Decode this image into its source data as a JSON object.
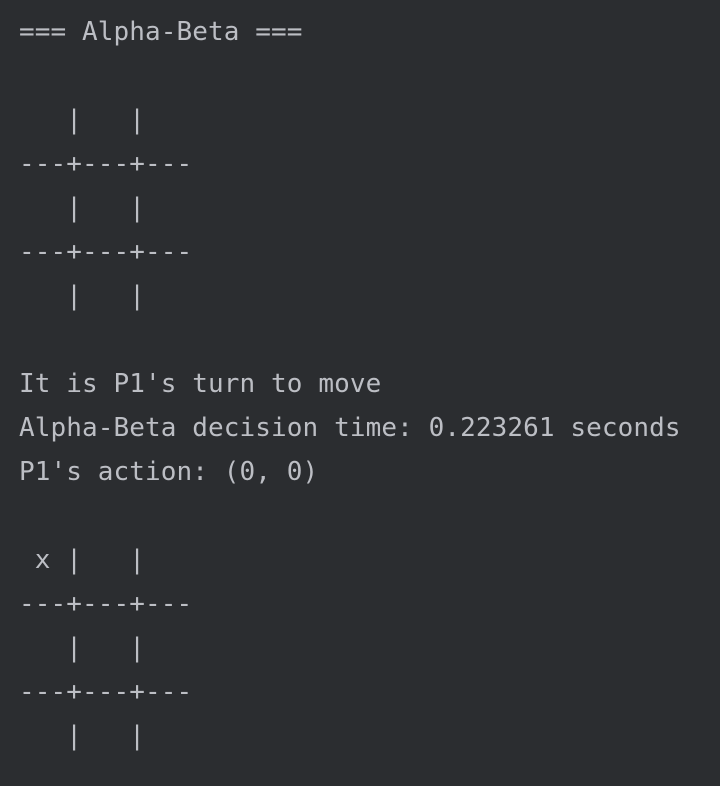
{
  "console": {
    "header": "=== Alpha-Beta ===",
    "board_initial": [
      "   |   |",
      "---+---+---",
      "   |   |",
      "---+---+---",
      "   |   |"
    ],
    "turn_message": "It is P1's turn to move",
    "decision_time": "Alpha-Beta decision time: 0.223261 seconds",
    "action": "P1's action: (0, 0)",
    "board_after": [
      " x |   |",
      "---+---+---",
      "   |   |",
      "---+---+---",
      "   |   |"
    ]
  },
  "colors": {
    "background": "#2b2d30",
    "text": "#bcbec4"
  }
}
